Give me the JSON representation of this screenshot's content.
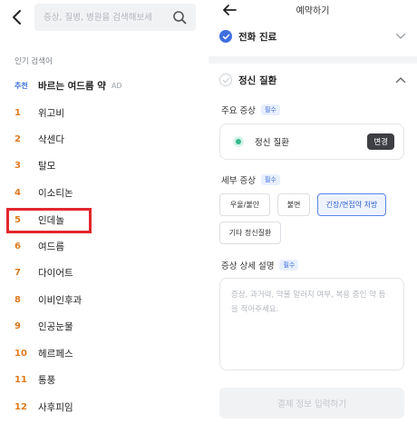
{
  "search": {
    "placeholder": "증상, 질병, 병원을 검색해보세",
    "value": ""
  },
  "popular": {
    "title": "인기 검색어",
    "ad": {
      "badge": "추천",
      "name": "바르는 여드름 약",
      "tag": "AD"
    },
    "items": [
      {
        "rank": "1",
        "name": "위고비"
      },
      {
        "rank": "2",
        "name": "삭센다"
      },
      {
        "rank": "3",
        "name": "탈모"
      },
      {
        "rank": "4",
        "name": "이소티논"
      },
      {
        "rank": "5",
        "name": "인데놀"
      },
      {
        "rank": "6",
        "name": "여드름"
      },
      {
        "rank": "7",
        "name": "다이어트"
      },
      {
        "rank": "8",
        "name": "이비인후과"
      },
      {
        "rank": "9",
        "name": "인공눈물"
      },
      {
        "rank": "10",
        "name": "헤르페스"
      },
      {
        "rank": "11",
        "name": "통풍"
      },
      {
        "rank": "12",
        "name": "사후피임"
      }
    ],
    "highlight_color": "#e3262c"
  },
  "booking": {
    "title": "예약하기",
    "section1": {
      "label": "전화 진료"
    },
    "section2": {
      "label": "정신 질환"
    },
    "main_symptom": {
      "label": "주요 증상",
      "required": "필수",
      "value": "정신 질환",
      "change": "변경"
    },
    "detail_symptom": {
      "label": "세부 증상",
      "required": "필수",
      "chips": [
        "우울/불안",
        "불면",
        "긴장/면접약 처방",
        "기타 정신질환"
      ],
      "selected": "긴장/면접약 처방"
    },
    "description": {
      "label": "증상 상세 설명",
      "required": "필수",
      "placeholder": "증상, 과거력, 약물 알러지 여부, 복용 중인 약 등을 적어주세요."
    },
    "submit": "결제 정보 입력하기"
  },
  "colors": {
    "accent": "#3f6fdd",
    "rank": "#e07a1f",
    "green": "#36b88c"
  }
}
